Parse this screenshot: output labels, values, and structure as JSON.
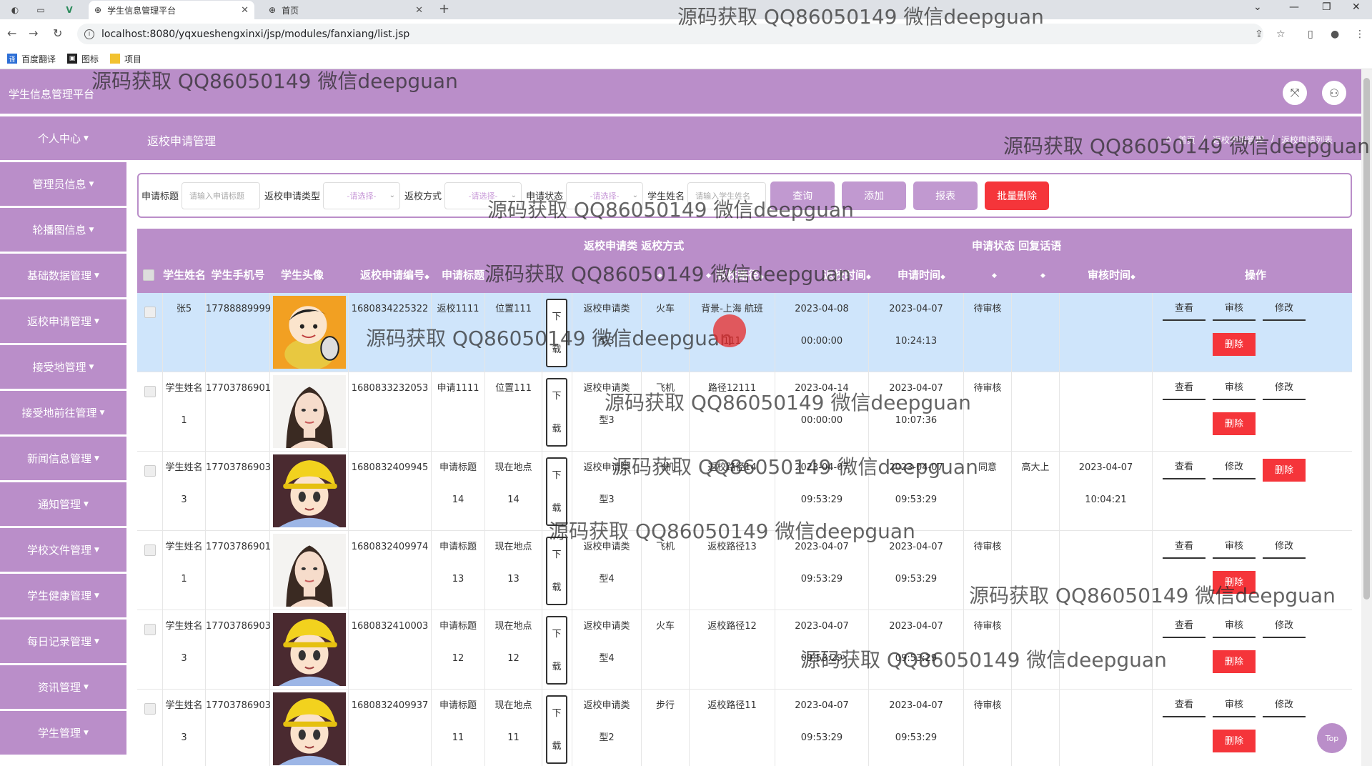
{
  "browser": {
    "tabs": [
      {
        "title": "学生信息管理平台",
        "active": true
      },
      {
        "title": "首页",
        "active": false
      }
    ],
    "url": "localhost:8080/yqxueshengxinxi/jsp/modules/fanxiang/list.jsp",
    "bookmarks": [
      "百度翻译",
      "图标",
      "项目"
    ]
  },
  "app": {
    "brand": "学生信息管理平台",
    "page_title": "返校申请管理",
    "breadcrumb": [
      "首页",
      "返校申请管理",
      "返校申请列表"
    ]
  },
  "sidebar": {
    "items": [
      {
        "label": "个人中心"
      },
      {
        "label": "管理员信息"
      },
      {
        "label": "轮播图信息"
      },
      {
        "label": "基础数据管理"
      },
      {
        "label": "返校申请管理"
      },
      {
        "label": "接受地管理"
      },
      {
        "label": "接受地前往管理"
      },
      {
        "label": "新闻信息管理"
      },
      {
        "label": "通知管理"
      },
      {
        "label": "学校文件管理"
      },
      {
        "label": "学生健康管理"
      },
      {
        "label": "每日记录管理"
      },
      {
        "label": "资讯管理"
      },
      {
        "label": "学生管理"
      }
    ]
  },
  "search": {
    "title_label": "申请标题",
    "title_placeholder": "请输入申请标题",
    "type_label": "返校申请类型",
    "type_placeholder": "-请选择-",
    "mode_label": "返校方式",
    "mode_placeholder": "-请选择-",
    "status_label": "申请状态",
    "status_placeholder": "-请选择-",
    "name_label": "学生姓名",
    "name_placeholder": "请输入学生姓名",
    "btn_query": "查询",
    "btn_add": "添加",
    "btn_report": "报表",
    "btn_batch_delete": "批量删除"
  },
  "table": {
    "group_header_1": "返校申请类  返校方式",
    "group_header_2": "申请状态  回复话语",
    "headers": {
      "name": "学生姓名",
      "phone": "学生手机号",
      "avatar": "学生头像",
      "code": "返校申请编号",
      "title": "申请标题",
      "route": "返校路径",
      "start_time": "返校时间",
      "apply_time": "申请时间",
      "review_time": "审核时间",
      "ops": "操作"
    },
    "sort_mark": "◆",
    "download_label": [
      "下",
      "载"
    ],
    "ops": {
      "view": "查看",
      "review": "审核",
      "edit": "修改",
      "delete": "删除"
    },
    "rows": [
      {
        "name": [
          "张5",
          ""
        ],
        "phone": "17788889999",
        "avatar": "cartoon-boy",
        "code": "1680834225322",
        "title": [
          "返校1111",
          ""
        ],
        "location": [
          "位置111",
          ""
        ],
        "type": [
          "返校申请类",
          "型3"
        ],
        "mode": "火车",
        "route": [
          "背景-上海 航班",
          "111"
        ],
        "start": [
          "2023-04-08",
          "00:00:00"
        ],
        "apply": [
          "2023-04-07",
          "10:24:13"
        ],
        "status": "待审核",
        "reply": "",
        "review_time": [
          "",
          ""
        ],
        "reviewed": false
      },
      {
        "name": [
          "学生姓名",
          "1"
        ],
        "phone": "17703786901",
        "avatar": "woman-portrait",
        "code": "1680833232053",
        "title": [
          "申请1111",
          ""
        ],
        "location": [
          "位置111",
          ""
        ],
        "type": [
          "返校申请类",
          "型3"
        ],
        "mode": "飞机",
        "route": [
          "路径12111",
          ""
        ],
        "start": [
          "2023-04-14",
          "00:00:00"
        ],
        "apply": [
          "2023-04-07",
          "10:07:36"
        ],
        "status": "待审核",
        "reply": "",
        "review_time": [
          "",
          ""
        ],
        "reviewed": false
      },
      {
        "name": [
          "学生姓名",
          "3"
        ],
        "phone": "17703786903",
        "avatar": "anime-boy",
        "code": "1680832409945",
        "title": [
          "申请标题",
          "14"
        ],
        "location": [
          "现在地点",
          "14"
        ],
        "type": [
          "返校申请类",
          "型3"
        ],
        "mode": "飞机",
        "route": [
          "返校路径14",
          ""
        ],
        "start": [
          "2023-04-07",
          "09:53:29"
        ],
        "apply": [
          "2023-04-07",
          "09:53:29"
        ],
        "status": "同意",
        "reply": "高大上",
        "review_time": [
          "2023-04-07",
          "10:04:21"
        ],
        "reviewed": true
      },
      {
        "name": [
          "学生姓名",
          "1"
        ],
        "phone": "17703786901",
        "avatar": "woman-portrait",
        "code": "1680832409974",
        "title": [
          "申请标题",
          "13"
        ],
        "location": [
          "现在地点",
          "13"
        ],
        "type": [
          "返校申请类",
          "型4"
        ],
        "mode": "飞机",
        "route": [
          "返校路径13",
          ""
        ],
        "start": [
          "2023-04-07",
          "09:53:29"
        ],
        "apply": [
          "2023-04-07",
          "09:53:29"
        ],
        "status": "待审核",
        "reply": "",
        "review_time": [
          "",
          ""
        ],
        "reviewed": false
      },
      {
        "name": [
          "学生姓名",
          "3"
        ],
        "phone": "17703786903",
        "avatar": "anime-boy",
        "code": "1680832410003",
        "title": [
          "申请标题",
          "12"
        ],
        "location": [
          "现在地点",
          "12"
        ],
        "type": [
          "返校申请类",
          "型4"
        ],
        "mode": "火车",
        "route": [
          "返校路径12",
          ""
        ],
        "start": [
          "2023-04-07",
          "09:53:29"
        ],
        "apply": [
          "2023-04-07",
          "09:53:29"
        ],
        "status": "待审核",
        "reply": "",
        "review_time": [
          "",
          ""
        ],
        "reviewed": false
      },
      {
        "name": [
          "学生姓名",
          "3"
        ],
        "phone": "17703786903",
        "avatar": "anime-boy",
        "code": "1680832409937",
        "title": [
          "申请标题",
          "11"
        ],
        "location": [
          "现在地点",
          "11"
        ],
        "type": [
          "返校申请类",
          "型2"
        ],
        "mode": "步行",
        "route": [
          "返校路径11",
          ""
        ],
        "start": [
          "2023-04-07",
          "09:53:29"
        ],
        "apply": [
          "2023-04-07",
          "09:53:29"
        ],
        "status": "待审核",
        "reply": "",
        "review_time": [
          "",
          ""
        ],
        "reviewed": false
      }
    ]
  },
  "top_button": "Top",
  "watermark": "源码获取 QQ86050149 微信deepguan",
  "colors": {
    "theme": "#ba8ec9",
    "danger": "#f5353a",
    "highlight_row": "#cfe5fb"
  }
}
